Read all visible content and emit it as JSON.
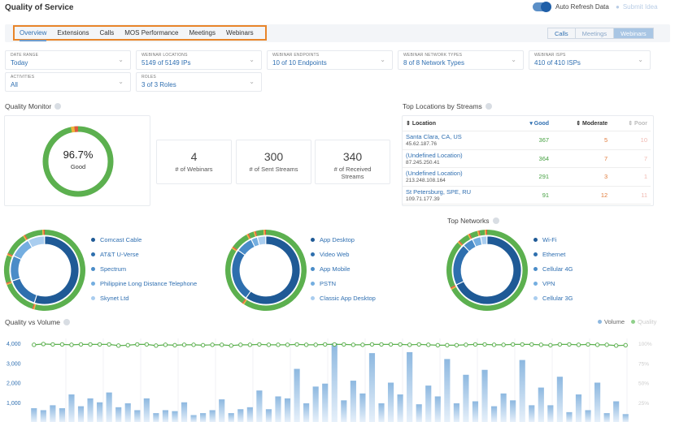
{
  "header": {
    "title": "Quality of Service",
    "auto_refresh_label": "Auto Refresh Data",
    "auto_refresh_on": true,
    "submit_label": "Submit Idea"
  },
  "tabs": [
    {
      "label": "Overview",
      "active": true
    },
    {
      "label": "Extensions",
      "active": false
    },
    {
      "label": "Calls",
      "active": false
    },
    {
      "label": "MOS Performance",
      "active": false
    },
    {
      "label": "Meetings",
      "active": false
    },
    {
      "label": "Webinars",
      "active": false
    }
  ],
  "segment": {
    "options": [
      "Calls",
      "Meetings",
      "Webinars"
    ],
    "selected": "Webinars"
  },
  "filters": [
    {
      "label": "DATE RANGE",
      "value": "Today"
    },
    {
      "label": "WEBINAR LOCATIONS",
      "value": "5149 of 5149 IPs"
    },
    {
      "label": "WEBINAR ENDPOINTS",
      "value": "10 of 10 Endpoints"
    },
    {
      "label": "WEBINAR NETWORK TYPES",
      "value": "8 of 8 Network Types"
    },
    {
      "label": "WEBINAR ISPS",
      "value": "410 of 410 ISPs"
    },
    {
      "label": "ACTIVITIES",
      "value": "All"
    },
    {
      "label": "ROLES",
      "value": "3 of 3 Roles"
    }
  ],
  "quality_monitor": {
    "title": "Quality Monitor",
    "percent": "96.7%",
    "status": "Good",
    "good_fraction": 0.967,
    "colors": {
      "good": "#5cb04f",
      "moderate": "#f0b43a",
      "poor": "#e0593e"
    }
  },
  "stats": [
    {
      "value": "4",
      "label": "# of Webinars"
    },
    {
      "value": "300",
      "label": "# of Sent Streams"
    },
    {
      "value": "340",
      "label": "# of Received Streams"
    }
  ],
  "top_locations": {
    "title": "Top Locations by Streams",
    "columns": [
      "Location",
      "Good",
      "Moderate",
      "Poor"
    ],
    "rows": [
      {
        "name": "Santa Clara, CA, US",
        "ip": "45.62.187.76",
        "good": "367",
        "moderate": "5",
        "poor": "10"
      },
      {
        "name": "(Undefined Location)",
        "ip": "87.245.250.41",
        "good": "364",
        "moderate": "7",
        "poor": "7"
      },
      {
        "name": "(Undefined Location)",
        "ip": "213.248.108.164",
        "good": "291",
        "moderate": "3",
        "poor": "1"
      },
      {
        "name": "St Petersburg, SPE, RU",
        "ip": "109.71.177.39",
        "good": "91",
        "moderate": "12",
        "poor": "11"
      }
    ]
  },
  "donuts": [
    {
      "title": "",
      "legend": [
        "Comcast Cable",
        "AT&T U-Verse",
        "Spectrum",
        "Philippine Long Distance Telephone",
        "Skynet Ltd"
      ],
      "inner": [
        0.55,
        0.15,
        0.12,
        0.1,
        0.08
      ]
    },
    {
      "title": "",
      "legend": [
        "App Desktop",
        "Video Web",
        "App Mobile",
        "PSTN",
        "Classic App Desktop"
      ],
      "inner": [
        0.6,
        0.25,
        0.08,
        0.03,
        0.04
      ]
    },
    {
      "title": "Top Networks",
      "legend": [
        "Wi-Fi",
        "Ethernet",
        "Cellular 4G",
        "VPN",
        "Cellular 3G"
      ],
      "inner": [
        0.68,
        0.2,
        0.05,
        0.04,
        0.03
      ]
    }
  ],
  "palette": [
    "#1f5a96",
    "#2e6fae",
    "#4a8cc8",
    "#74aee0",
    "#a9cdef"
  ],
  "chart_data": {
    "type": "bar",
    "title": "Quality vs Volume",
    "legend": [
      "Volume",
      "Quality"
    ],
    "legend_position": "top-right",
    "y_left": {
      "ticks": [
        "4,000",
        "3,000",
        "2,000",
        "1,000"
      ],
      "range": [
        0,
        4000
      ]
    },
    "y_right": {
      "ticks": [
        "100%",
        "75%",
        "50%",
        "25%"
      ],
      "range": [
        0,
        100
      ]
    },
    "series": [
      {
        "name": "Volume",
        "values": [
          700,
          600,
          850,
          700,
          1400,
          800,
          1200,
          1000,
          1500,
          750,
          950,
          600,
          1200,
          450,
          600,
          550,
          1000,
          350,
          450,
          600,
          1150,
          450,
          650,
          750,
          1600,
          650,
          1300,
          1200,
          2700,
          950,
          1800,
          1950,
          4000,
          1100,
          2100,
          1450,
          3500,
          950,
          2000,
          1400,
          3550,
          900,
          1850,
          1300,
          3200,
          950,
          2400,
          1050,
          2650,
          800,
          1450,
          1100,
          3150,
          850,
          1750,
          850,
          2300,
          500,
          1400,
          600,
          2000,
          450,
          1050,
          400
        ]
      },
      {
        "name": "Quality",
        "values": [
          96,
          97,
          96.5,
          96.5,
          96,
          96.5,
          96.5,
          96.5,
          96.5,
          95,
          95.5,
          96.5,
          96.5,
          95,
          96,
          95.5,
          96,
          96,
          95.5,
          96,
          96,
          95,
          96,
          96,
          96.5,
          96,
          96,
          96,
          96.5,
          96,
          96,
          96.5,
          96.5,
          96.5,
          96,
          96,
          96.5,
          96.5,
          96.5,
          96.5,
          96,
          96.5,
          96,
          95.5,
          95.5,
          95.5,
          96,
          96.5,
          96.5,
          96,
          96,
          96.5,
          96.5,
          96.5,
          96,
          95.5,
          96.5,
          96.5,
          96,
          96.5,
          96,
          96,
          95,
          95.5
        ]
      }
    ],
    "colors": {
      "volume": "#8db8e0",
      "quality": "#5cb04f"
    }
  }
}
